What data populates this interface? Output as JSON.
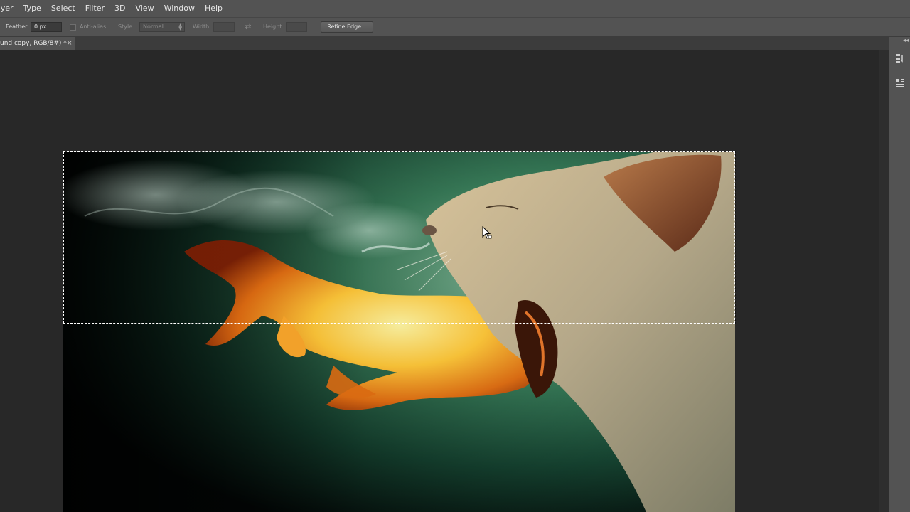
{
  "menubar": {
    "items": [
      "ayer",
      "Type",
      "Select",
      "Filter",
      "3D",
      "View",
      "Window",
      "Help"
    ]
  },
  "options_bar": {
    "feather_label": "Feather:",
    "feather_value": "0 px",
    "antialias_label": "Anti-alias",
    "style_label": "Style:",
    "style_value": "Normal",
    "width_label": "Width:",
    "height_label": "Height:",
    "refine_edge_label": "Refine Edge..."
  },
  "document_tab": {
    "title": "und copy, RGB/8#) *",
    "close_glyph": "×"
  },
  "colors": {
    "ui_panel": "#535353",
    "workspace": "#282828",
    "selection_marquee": "#ffffff"
  },
  "icons": {
    "tab_close": "close-icon",
    "swap": "swap-width-height-icon",
    "right_panel": [
      "history-panel-icon",
      "properties-panel-icon"
    ],
    "cursor": "move-cursor-icon"
  }
}
